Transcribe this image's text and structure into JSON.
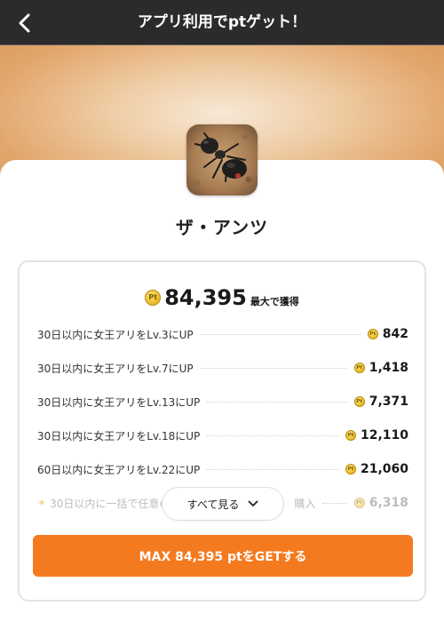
{
  "header": {
    "title": "アプリ利用でptゲット！",
    "back_icon": "chevron-left-icon"
  },
  "app": {
    "name": "ザ・アンツ",
    "icon": "ant-app-icon"
  },
  "reward": {
    "total": "84,395",
    "suffix": "最大で獲得"
  },
  "tasks": [
    {
      "label": "30日以内に女王アリをLv.3にUP",
      "points": "842"
    },
    {
      "label": "30日以内に女王アリをLv.7にUP",
      "points": "1,418"
    },
    {
      "label": "30日以内に女王アリをLv.13にUP",
      "points": "7,371"
    },
    {
      "label": "30日以内に女王アリをLv.18にUP",
      "points": "12,110"
    },
    {
      "label": "60日以内に女王アリをLv.22にUP",
      "points": "21,060"
    },
    {
      "label_left": "30日以内に一括で任意の",
      "label_right": "購入",
      "points": "6,318"
    }
  ],
  "see_all": {
    "label": "すべて見る"
  },
  "cta": {
    "label": "MAX 84,395 ptをGETする"
  },
  "colors": {
    "accent": "#f47a20",
    "header_bg": "#2b2b2b",
    "coin": "#e8b923"
  }
}
